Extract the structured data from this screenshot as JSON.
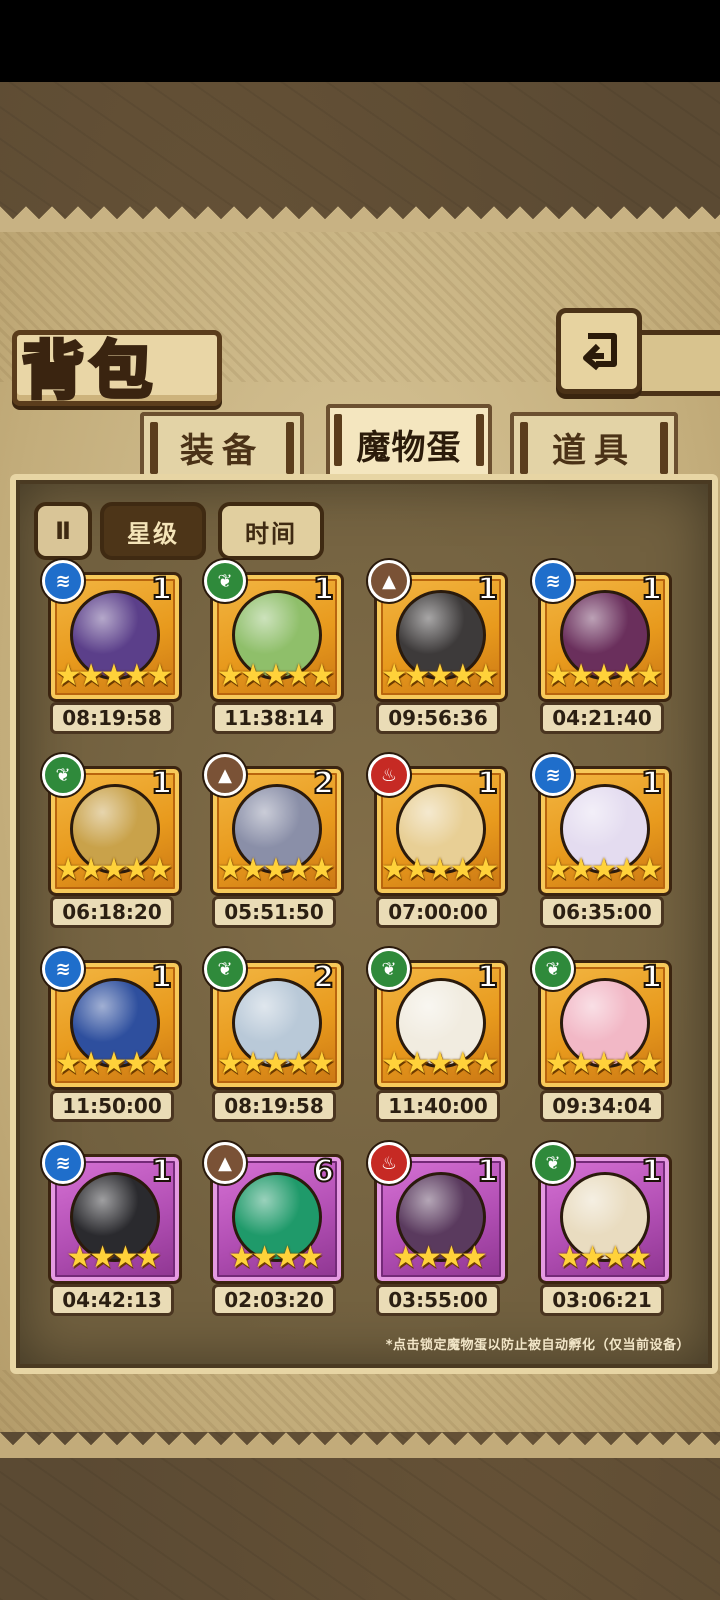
{
  "title": "背包",
  "tabs": [
    {
      "label": "装备",
      "active": false
    },
    {
      "label": "魔物蛋",
      "active": true
    },
    {
      "label": "道具",
      "active": false
    }
  ],
  "sort": {
    "icon": "sort-toggle-icon",
    "label": "Ⅱ"
  },
  "filters": {
    "star": "星级",
    "time": "时间"
  },
  "eggs": [
    {
      "element": "water",
      "count": "1",
      "stars": "★★★★★",
      "time": "08:19:58",
      "frame": "gold",
      "art_color": "#5b3f8a"
    },
    {
      "element": "grass",
      "count": "1",
      "stars": "★★★★★",
      "time": "11:38:14",
      "frame": "gold",
      "art_color": "#8fbf6a"
    },
    {
      "element": "earth",
      "count": "1",
      "stars": "★★★★★",
      "time": "09:56:36",
      "frame": "gold",
      "art_color": "#3d3a3a"
    },
    {
      "element": "water",
      "count": "1",
      "stars": "★★★★★",
      "time": "04:21:40",
      "frame": "gold",
      "art_color": "#6a2f5c"
    },
    {
      "element": "grass",
      "count": "1",
      "stars": "★★★★★",
      "time": "06:18:20",
      "frame": "gold",
      "art_color": "#c9a24a"
    },
    {
      "element": "earth",
      "count": "2",
      "stars": "★★★★★",
      "time": "05:51:50",
      "frame": "gold",
      "art_color": "#8a8fa8"
    },
    {
      "element": "fire",
      "count": "1",
      "stars": "★★★★★",
      "time": "07:00:00",
      "frame": "gold",
      "art_color": "#e8cf95"
    },
    {
      "element": "water",
      "count": "1",
      "stars": "★★★★★",
      "time": "06:35:00",
      "frame": "gold",
      "art_color": "#e4dcf0"
    },
    {
      "element": "water",
      "count": "1",
      "stars": "★★★★★",
      "time": "11:50:00",
      "frame": "gold",
      "art_color": "#2e4f9e"
    },
    {
      "element": "grass",
      "count": "2",
      "stars": "★★★★★",
      "time": "08:19:58",
      "frame": "gold",
      "art_color": "#b9c9d8"
    },
    {
      "element": "grass",
      "count": "1",
      "stars": "★★★★★",
      "time": "11:40:00",
      "frame": "gold",
      "art_color": "#f1ece0"
    },
    {
      "element": "grass",
      "count": "1",
      "stars": "★★★★★",
      "time": "09:34:04",
      "frame": "gold",
      "art_color": "#f2b8c6"
    },
    {
      "element": "water",
      "count": "1",
      "stars": "★★★★",
      "time": "04:42:13",
      "frame": "purple",
      "art_color": "#2a2a2e"
    },
    {
      "element": "earth",
      "count": "6",
      "stars": "★★★★",
      "time": "02:03:20",
      "frame": "purple",
      "art_color": "#1f9a6a"
    },
    {
      "element": "fire",
      "count": "1",
      "stars": "★★★★",
      "time": "03:55:00",
      "frame": "purple",
      "art_color": "#5a3a5e"
    },
    {
      "element": "grass",
      "count": "1",
      "stars": "★★★★",
      "time": "03:06:21",
      "frame": "purple",
      "art_color": "#e9dcc0"
    }
  ],
  "element_glyphs": {
    "water": "≋",
    "grass": "❦",
    "earth": "▲",
    "fire": "♨"
  },
  "footnote": "*点击锁定魔物蛋以防止被自动孵化（仅当前设备）",
  "colors": {
    "gold_frame": "#e89a1d",
    "purple_frame": "#b24fb4",
    "star": "#ffd23a"
  }
}
